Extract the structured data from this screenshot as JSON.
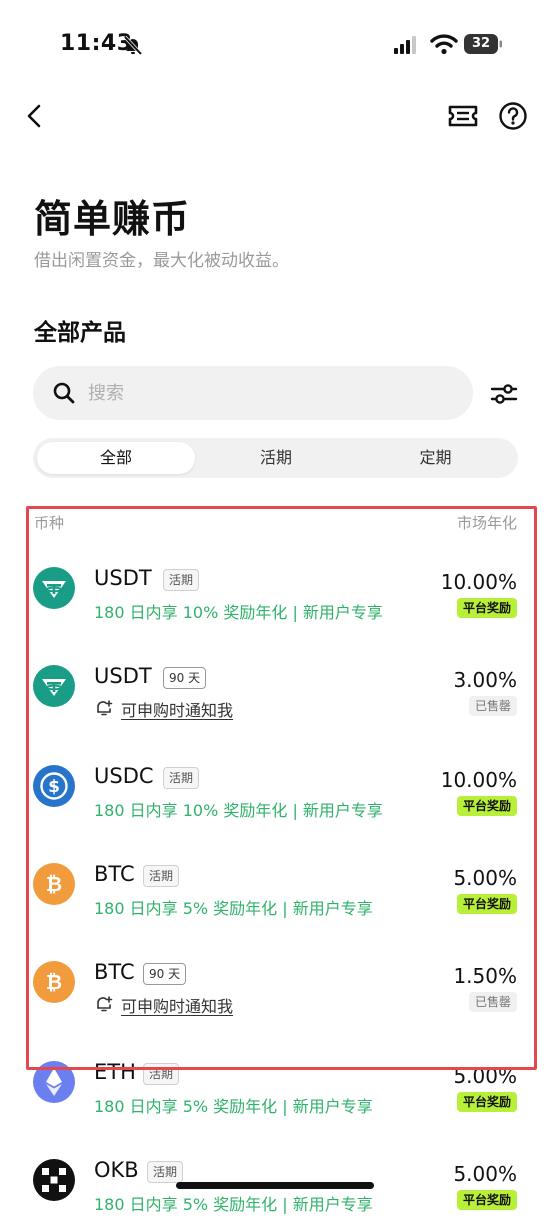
{
  "status_bar": {
    "time": "11:43",
    "battery": "32"
  },
  "page": {
    "title": "简单赚币",
    "subtitle": "借出闲置资金，最大化被动收益。",
    "section_title": "全部产品"
  },
  "search": {
    "placeholder": "搜索",
    "value": ""
  },
  "tabs": [
    "全部",
    "活期",
    "定期"
  ],
  "active_tab": "全部",
  "list_header": {
    "left": "币种",
    "right": "市场年化"
  },
  "products": [
    {
      "coin": "USDT",
      "icon": "tether-icon",
      "tag": "活期",
      "detail": "180 日内享 10% 奖励年化 | 新用户专享",
      "detail_type": "promo",
      "rate": "10.00%",
      "badge": "平台奖励",
      "badge_type": "reward"
    },
    {
      "coin": "USDT",
      "icon": "tether-icon",
      "tag": "90 天",
      "detail": "可申购时通知我",
      "detail_type": "notify",
      "rate": "3.00%",
      "badge": "已售罄",
      "badge_type": "sold"
    },
    {
      "coin": "USDC",
      "icon": "usdc-icon",
      "tag": "活期",
      "detail": "180 日内享 10% 奖励年化 | 新用户专享",
      "detail_type": "promo",
      "rate": "10.00%",
      "badge": "平台奖励",
      "badge_type": "reward"
    },
    {
      "coin": "BTC",
      "icon": "bitcoin-icon",
      "tag": "活期",
      "detail": "180 日内享 5% 奖励年化 | 新用户专享",
      "detail_type": "promo",
      "rate": "5.00%",
      "badge": "平台奖励",
      "badge_type": "reward"
    },
    {
      "coin": "BTC",
      "icon": "bitcoin-icon",
      "tag": "90 天",
      "detail": "可申购时通知我",
      "detail_type": "notify",
      "rate": "1.50%",
      "badge": "已售罄",
      "badge_type": "sold"
    },
    {
      "coin": "ETH",
      "icon": "ethereum-icon",
      "tag": "活期",
      "detail": "180 日内享 5% 奖励年化 | 新用户专享",
      "detail_type": "promo",
      "rate": "5.00%",
      "badge": "平台奖励",
      "badge_type": "reward"
    },
    {
      "coin": "OKB",
      "icon": "okb-icon",
      "tag": "活期",
      "detail": "180 日内享 5% 奖励年化 | 新用户专享",
      "detail_type": "promo",
      "rate": "5.00%",
      "badge": "平台奖励",
      "badge_type": "reward"
    }
  ],
  "colors": {
    "promo_green": "#2fb36b",
    "reward_badge": "#b8ef38",
    "highlight_frame": "#e5474e",
    "tether": "#1a9d87",
    "usdc": "#2775ca",
    "bitcoin": "#f29b3c",
    "ethereum": "#6b7ff0"
  }
}
